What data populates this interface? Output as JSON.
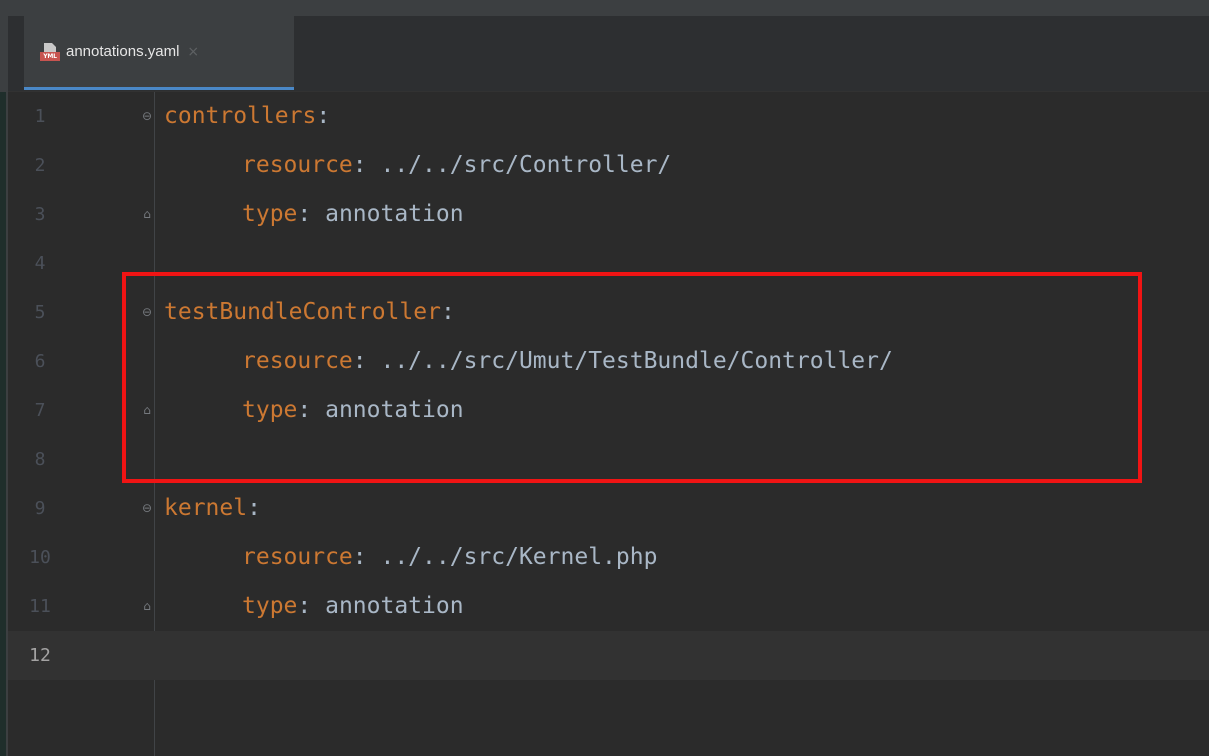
{
  "tab": {
    "file_icon_badge": "YML",
    "title": "annotations.yaml",
    "close_glyph": "×"
  },
  "editor": {
    "lines": [
      {
        "num": "1",
        "key": "controllers",
        "sep": ":",
        "value": "",
        "indent": false,
        "fold": "open"
      },
      {
        "num": "2",
        "key": "resource",
        "sep": ": ",
        "value": "../../src/Controller/",
        "indent": true,
        "fold": ""
      },
      {
        "num": "3",
        "key": "type",
        "sep": ": ",
        "value": "annotation",
        "indent": true,
        "fold": "close"
      },
      {
        "num": "4",
        "key": "",
        "sep": "",
        "value": "",
        "indent": false,
        "fold": ""
      },
      {
        "num": "5",
        "key": "testBundleController",
        "sep": ":",
        "value": "",
        "indent": false,
        "fold": "open"
      },
      {
        "num": "6",
        "key": "resource",
        "sep": ": ",
        "value": "../../src/Umut/TestBundle/Controller/",
        "indent": true,
        "fold": ""
      },
      {
        "num": "7",
        "key": "type",
        "sep": ": ",
        "value": "annotation",
        "indent": true,
        "fold": "close"
      },
      {
        "num": "8",
        "key": "",
        "sep": "",
        "value": "",
        "indent": false,
        "fold": ""
      },
      {
        "num": "9",
        "key": "kernel",
        "sep": ":",
        "value": "",
        "indent": false,
        "fold": "open"
      },
      {
        "num": "10",
        "key": "resource",
        "sep": ": ",
        "value": "../../src/Kernel.php",
        "indent": true,
        "fold": ""
      },
      {
        "num": "11",
        "key": "type",
        "sep": ": ",
        "value": "annotation",
        "indent": true,
        "fold": "close"
      },
      {
        "num": "12",
        "key": "",
        "sep": "",
        "value": "",
        "indent": false,
        "fold": ""
      }
    ],
    "current_line": "12",
    "highlighted_lines": [
      "5",
      "6",
      "7",
      "8"
    ]
  },
  "icons": {
    "file": "yaml-file-icon",
    "close": "close-icon",
    "fold_open": "fold-open-icon",
    "fold_close": "fold-close-icon"
  },
  "colors": {
    "background": "#2b2b2b",
    "key": "#cc7832",
    "text": "#a9b7c6",
    "line_number": "#4b5059",
    "highlight_box": "#f01414",
    "tab_underline": "#4a88c7"
  }
}
